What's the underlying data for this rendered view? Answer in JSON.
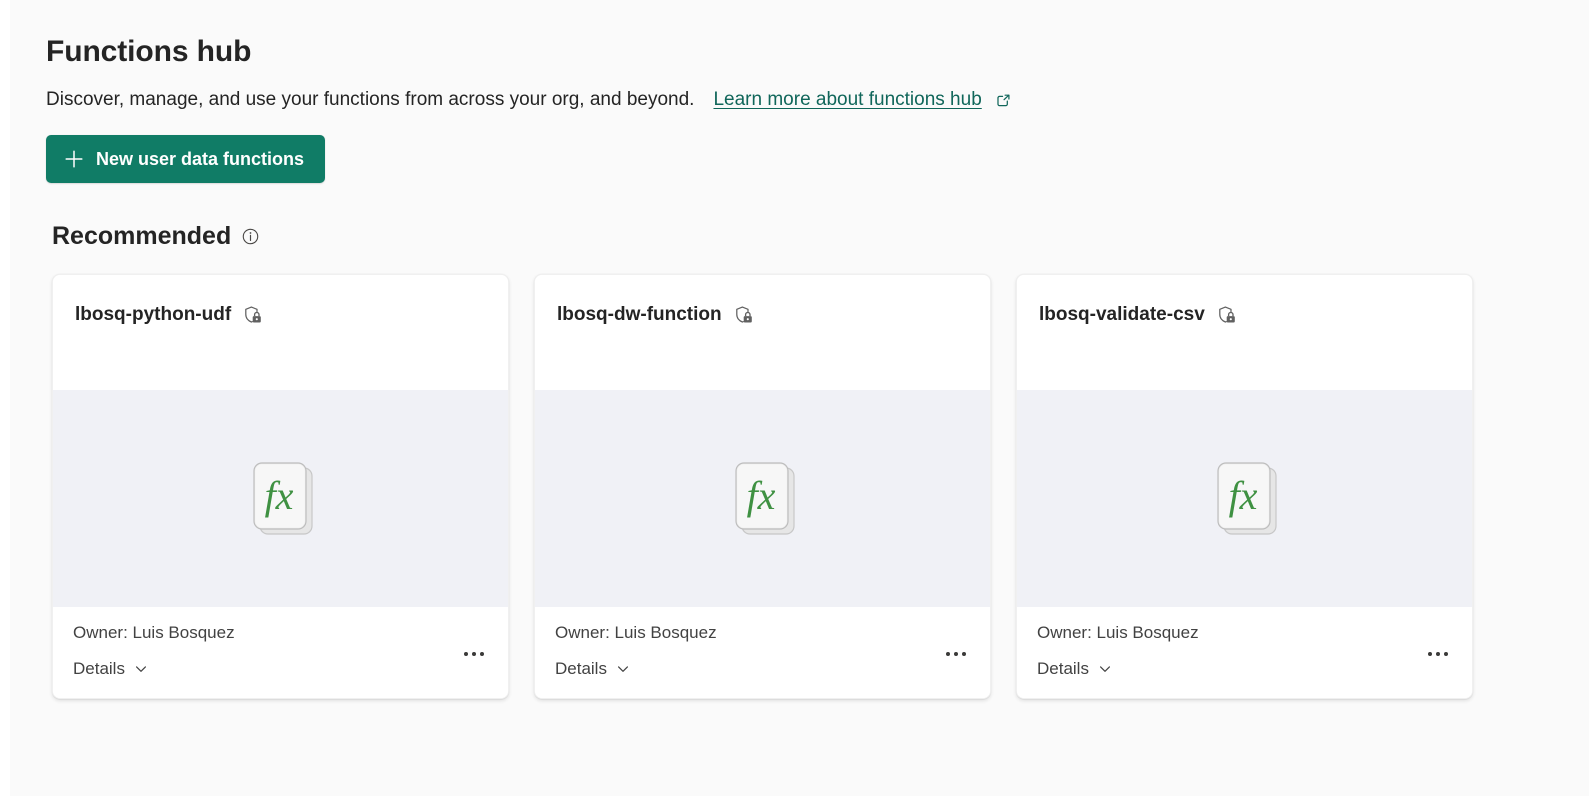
{
  "header": {
    "title": "Functions hub",
    "subtitle": "Discover, manage, and use your functions from across your org, and beyond.",
    "learn_more_label": "Learn more about functions hub",
    "learn_more_icon": "external-link-icon",
    "new_function_button": "New user data functions",
    "new_function_icon": "plus-icon",
    "accent_color": "#107c66",
    "link_color": "#10665a"
  },
  "section": {
    "title": "Recommended",
    "info_icon": "info-icon"
  },
  "cards": [
    {
      "title": "lbosq-python-udf",
      "security_icon": "shield-lock-icon",
      "thumbnail_icon": "fx-function-icon",
      "owner": "Owner: Luis Bosquez",
      "details_label": "Details",
      "details_icon": "chevron-down-icon",
      "more_options_icon": "more-options-icon"
    },
    {
      "title": "lbosq-dw-function",
      "security_icon": "shield-lock-icon",
      "thumbnail_icon": "fx-function-icon",
      "owner": "Owner: Luis Bosquez",
      "details_label": "Details",
      "details_icon": "chevron-down-icon",
      "more_options_icon": "more-options-icon"
    },
    {
      "title": "lbosq-validate-csv",
      "security_icon": "shield-lock-icon",
      "thumbnail_icon": "fx-function-icon",
      "owner": "Owner: Luis Bosquez",
      "details_label": "Details",
      "details_icon": "chevron-down-icon",
      "more_options_icon": "more-options-icon"
    }
  ]
}
